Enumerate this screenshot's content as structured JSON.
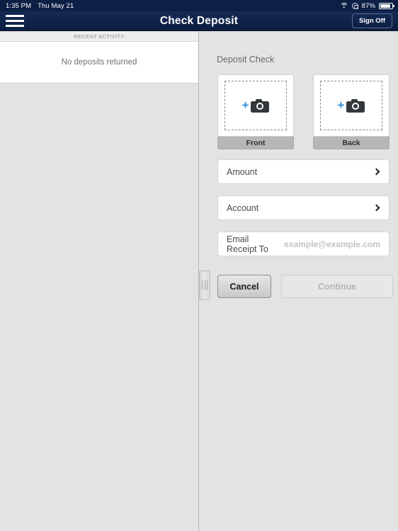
{
  "statusbar": {
    "time": "1:35 PM",
    "date": "Thu May 21",
    "battery_percent": "87%",
    "wifi_icon": "wifi-icon",
    "rotation_lock_icon": "rotation-lock-icon",
    "battery_icon": "battery-icon"
  },
  "navbar": {
    "menu_icon": "hamburger-menu-icon",
    "title": "Check Deposit",
    "sign_off_label": "Sign Off"
  },
  "left_panel": {
    "section_header": "RECENT ACTIVITY",
    "empty_message": "No deposits returned"
  },
  "right_panel": {
    "section_title": "Deposit Check",
    "captures": [
      {
        "label": "Front",
        "icon": "camera-icon",
        "plus": "+"
      },
      {
        "label": "Back",
        "icon": "camera-icon",
        "plus": "+"
      }
    ],
    "fields": [
      {
        "label": "Amount",
        "accessory": "chevron-right-icon"
      },
      {
        "label": "Account",
        "accessory": "chevron-right-icon"
      }
    ],
    "email": {
      "label": "Email Receipt To",
      "value": "",
      "placeholder": "example@example.com"
    },
    "buttons": {
      "cancel_label": "Cancel",
      "continue_label": "Continue",
      "continue_enabled": false
    },
    "splitter_icon": "drag-handle-icon"
  },
  "colors": {
    "navbar_navy": "#0f2349",
    "status_navy": "#0c1f45",
    "accent_blue": "#2b8fe0",
    "panel_gray": "#e3e3e3",
    "capture_label_gray": "#b6b6b6"
  }
}
